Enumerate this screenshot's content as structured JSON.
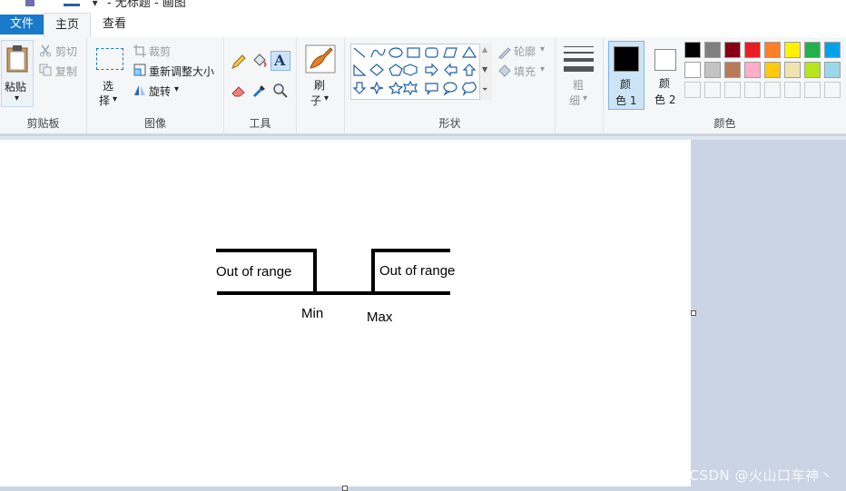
{
  "titlebar": {
    "title": "- 无标题 - 画图",
    "qat_arrow": "▾"
  },
  "tabs": {
    "file": "文件",
    "home": "主页",
    "view": "查看"
  },
  "clipboard": {
    "paste": "粘贴",
    "paste_arrow": "▾",
    "cut": "剪切",
    "copy": "复制",
    "group_label": "剪贴板"
  },
  "image": {
    "select_1": "选",
    "select_2": "择",
    "select_arrow": "▾",
    "crop": "裁剪",
    "resize": "重新调整大小",
    "rotate": "旋转",
    "rotate_arrow": "▾",
    "group_label": "图像"
  },
  "tools": {
    "text_tool": "A",
    "group_label": "工具"
  },
  "brushes": {
    "label_1": "刷",
    "label_2": "子",
    "arrow": "▾"
  },
  "shapes": {
    "outline": "轮廓",
    "fill": "填充",
    "arrow": "▾",
    "group_label": "形状"
  },
  "size": {
    "label_1": "粗",
    "label_2": "细",
    "arrow": "▾"
  },
  "colors": {
    "color1_line1": "颜",
    "color1_line2": "色 1",
    "color2_line1": "颜",
    "color2_line2": "色 2",
    "group_label": "颜色",
    "color1_value": "#000000",
    "color2_value": "#ffffff",
    "row1": [
      "#000000",
      "#7f7f7f",
      "#880015",
      "#ed1c24",
      "#ff7f27",
      "#fff200",
      "#22b14c",
      "#00a2e8"
    ],
    "row2": [
      "#ffffff",
      "#c3c3c3",
      "#b97a57",
      "#ffaec9",
      "#ffc90e",
      "#efe4b0",
      "#b5e61d",
      "#99d9ea"
    ]
  },
  "drawing": {
    "left_text": "Out of range",
    "right_text": "Out of range",
    "min_label": "Min",
    "max_label": "Max"
  },
  "watermark": "CSDN @火山口车神丶"
}
